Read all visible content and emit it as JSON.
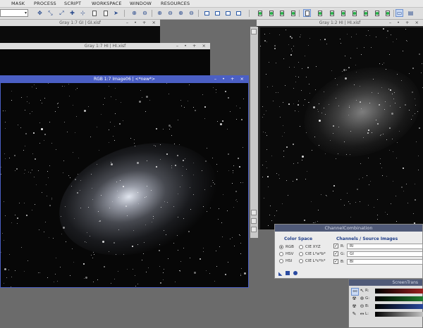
{
  "menu": [
    "MASK",
    "PROCESS",
    "SCRIPT",
    "WORKSPACE",
    "WINDOW",
    "RESOURCES"
  ],
  "windows": {
    "gi_title": "Gray 1:7 GI | GI.xisf",
    "hi_small_title": "Gray 1:7 HI | HI.xisf",
    "rgb_title": "RGB 1:7 Image06 | <*new*>",
    "hi_right_title": "Gray 1:2 HI | HI.xisf",
    "window_buttons": "– • + ×"
  },
  "channel_combination": {
    "title": "ChannelCombination",
    "color_space_title": "Color Space",
    "color_spaces": [
      {
        "label": "RGB",
        "selected": true
      },
      {
        "label": "CIE XYZ",
        "selected": false
      },
      {
        "label": "HSV",
        "selected": false
      },
      {
        "label": "CIE L*a*b*",
        "selected": false
      },
      {
        "label": "HSI",
        "selected": false
      },
      {
        "label": "CIE L*c*h*",
        "selected": false
      }
    ],
    "channels_title": "Channels / Source Images",
    "channels": [
      {
        "letter": "R:",
        "source": "RI",
        "checked": true
      },
      {
        "letter": "G:",
        "source": "GI",
        "checked": true
      },
      {
        "letter": "B:",
        "source": "BI",
        "checked": true
      }
    ]
  },
  "screen_transfer": {
    "title": "ScreenTrans",
    "channels": [
      "R:",
      "G:",
      "B:",
      "L:"
    ],
    "colors": [
      "#a02020",
      "#208030",
      "#2a4aa0",
      "#c8c8c8"
    ]
  },
  "accent": "#4b5fc4"
}
